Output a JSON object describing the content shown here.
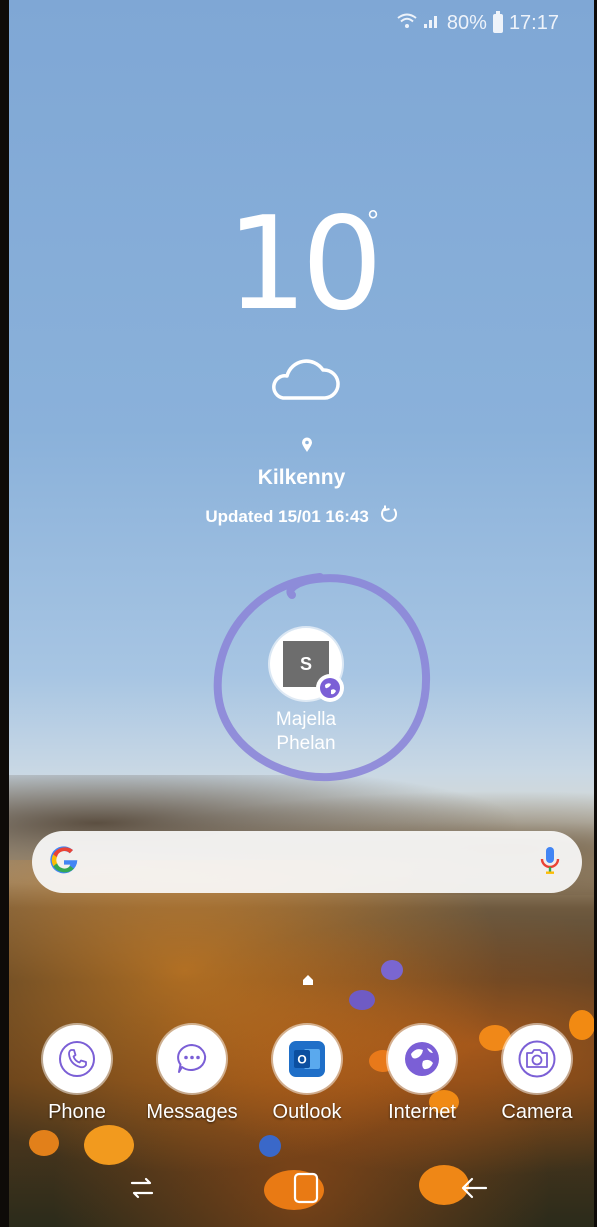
{
  "status_bar": {
    "battery": "80%",
    "time": "17:17"
  },
  "weather": {
    "temperature": "10",
    "degree_symbol": "°",
    "condition_icon": "cloud-icon",
    "location": "Kilkenny",
    "updated": "Updated 15/01 16:43"
  },
  "contact_shortcut": {
    "initial": "S",
    "name_line1": "Majella",
    "name_line2": "Phelan",
    "badge_icon": "globe-icon"
  },
  "search": {
    "logo": "G",
    "icon": "mic-icon"
  },
  "dock": [
    {
      "label": "Phone",
      "icon": "phone-icon"
    },
    {
      "label": "Messages",
      "icon": "chat-icon"
    },
    {
      "label": "Outlook",
      "icon": "outlook-icon"
    },
    {
      "label": "Internet",
      "icon": "globe-icon"
    },
    {
      "label": "Camera",
      "icon": "camera-icon"
    }
  ],
  "colors": {
    "accent_purple": "#7b5fd6",
    "outlook_blue": "#1f6fc8"
  }
}
